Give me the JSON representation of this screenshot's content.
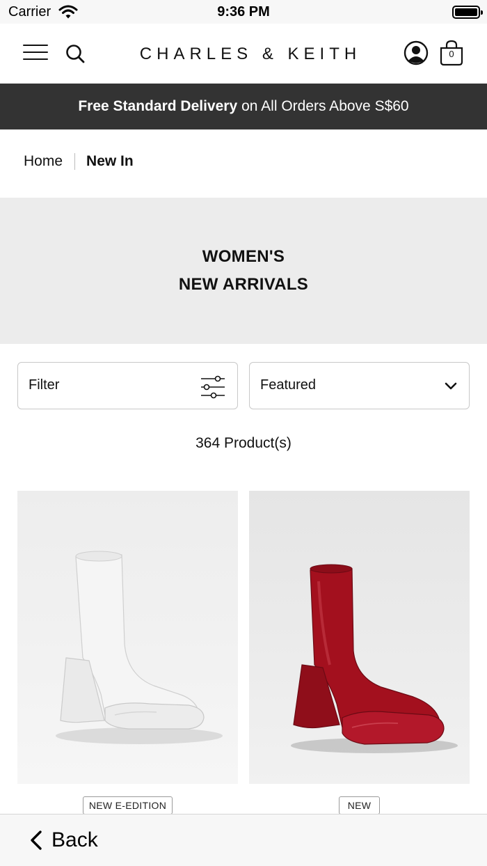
{
  "status_bar": {
    "carrier": "Carrier",
    "time": "9:36 PM"
  },
  "header": {
    "brand": "CHARLES & KEITH",
    "bag_count": "0",
    "icons": [
      "menu-icon",
      "search-icon",
      "account-icon",
      "shopping-bag-icon"
    ]
  },
  "promo": {
    "bold": "Free Standard Delivery",
    "rest": "on All Orders Above S$60"
  },
  "breadcrumb": {
    "home": "Home",
    "current": "New In"
  },
  "hero": {
    "line1": "WOMEN'S",
    "line2": "NEW ARRIVALS"
  },
  "controls": {
    "filter_label": "Filter",
    "sort_value": "Featured"
  },
  "product_count": "364 Product(s)",
  "products": [
    {
      "badge": "NEW E-EDITION",
      "image_color": "white"
    },
    {
      "badge": "NEW",
      "image_color": "red"
    }
  ],
  "back_bar": {
    "label": "Back"
  },
  "colors": {
    "promo_bg": "#333333",
    "hero_bg": "#ececec",
    "boot_red": "#a3101e"
  }
}
